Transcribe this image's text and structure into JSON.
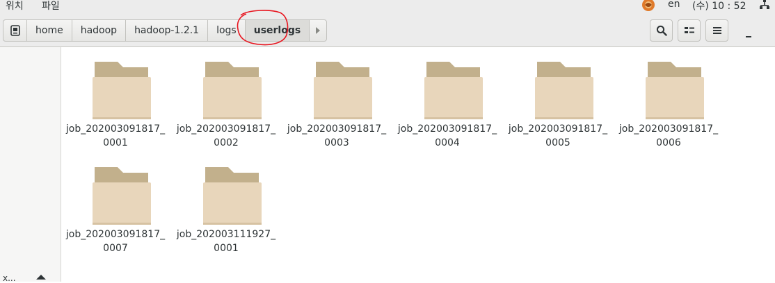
{
  "topbar": {
    "menu_places": "위치",
    "menu_app": "파일",
    "language": "en",
    "clock": "(수) 10 : 52",
    "sys_icon": "app-tray-icon",
    "net_icon": "network-icon"
  },
  "header": {
    "root_icon": "drive-icon",
    "path": [
      "home",
      "hadoop",
      "hadoop-1.2.1",
      "logs",
      "userlogs"
    ],
    "active_segment": "userlogs",
    "more_icon": "chevron-right-icon",
    "buttons": [
      "search-icon",
      "view-toggle-icon",
      "menu-icon"
    ],
    "minimize_icon": "minimize-icon"
  },
  "annotation": {
    "color": "#e8141e",
    "target": "userlogs"
  },
  "sidebar": {
    "truncated_label": "x...",
    "eject_icon": "eject-icon"
  },
  "folders": [
    {
      "line1": "job_202003091817_",
      "line2": "0001"
    },
    {
      "line1": "job_202003091817_",
      "line2": "0002"
    },
    {
      "line1": "job_202003091817_",
      "line2": "0003"
    },
    {
      "line1": "job_202003091817_",
      "line2": "0004"
    },
    {
      "line1": "job_202003091817_",
      "line2": "0005"
    },
    {
      "line1": "job_202003091817_",
      "line2": "0006"
    },
    {
      "line1": "job_202003091817_",
      "line2": "0007"
    },
    {
      "line1": "job_202003111927_",
      "line2": "0001"
    }
  ],
  "colors": {
    "folder_back": "#c2b08c",
    "folder_front": "#e8d6bb",
    "bar_bg": "#ececec"
  }
}
